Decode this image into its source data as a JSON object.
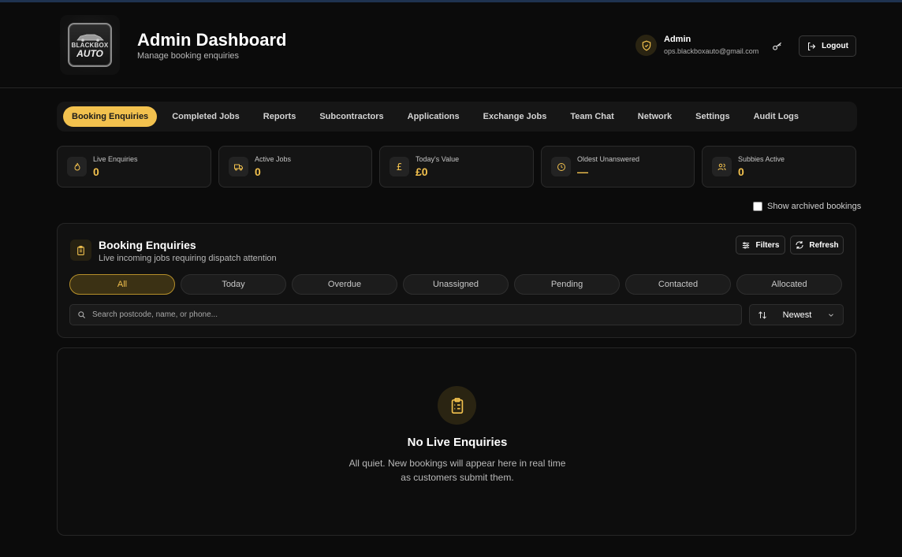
{
  "colors": {
    "accent": "#f2c14e",
    "background": "#0b0b0b",
    "panel": "#111111"
  },
  "header": {
    "logo_line1": "BLACKBOX",
    "logo_line2": "AUTO",
    "title": "Admin Dashboard",
    "subtitle": "Manage booking enquiries",
    "user_name": "Admin",
    "user_email": "ops.blackboxauto@gmail.com",
    "logout_label": "Logout"
  },
  "nav": {
    "items": [
      {
        "label": "Booking Enquiries",
        "active": true
      },
      {
        "label": "Completed Jobs"
      },
      {
        "label": "Reports"
      },
      {
        "label": "Subcontractors"
      },
      {
        "label": "Applications"
      },
      {
        "label": "Exchange Jobs"
      },
      {
        "label": "Team Chat"
      },
      {
        "label": "Network"
      },
      {
        "label": "Settings"
      },
      {
        "label": "Audit Logs"
      }
    ]
  },
  "stats": [
    {
      "label": "Live Enquiries",
      "value": "0",
      "icon": "flame-icon"
    },
    {
      "label": "Active Jobs",
      "value": "0",
      "icon": "truck-icon"
    },
    {
      "label": "Today's Value",
      "value": "£0",
      "icon": "pound-icon"
    },
    {
      "label": "Oldest Unanswered",
      "value": "—",
      "icon": "clock-icon"
    },
    {
      "label": "Subbies Active",
      "value": "0",
      "icon": "users-icon"
    }
  ],
  "archived_label": "Show archived bookings",
  "panel": {
    "title": "Booking Enquiries",
    "subtitle": "Live incoming jobs requiring dispatch attention",
    "filters_label": "Filters",
    "refresh_label": "Refresh",
    "chips": [
      "All",
      "Today",
      "Overdue",
      "Unassigned",
      "Pending",
      "Contacted",
      "Allocated"
    ],
    "active_chip": "All",
    "search_placeholder": "Search postcode, name, or phone...",
    "sort_value": "Newest"
  },
  "empty": {
    "title": "No Live Enquiries",
    "line1": "All quiet. New bookings will appear here in real time",
    "line2": "as customers submit them."
  }
}
